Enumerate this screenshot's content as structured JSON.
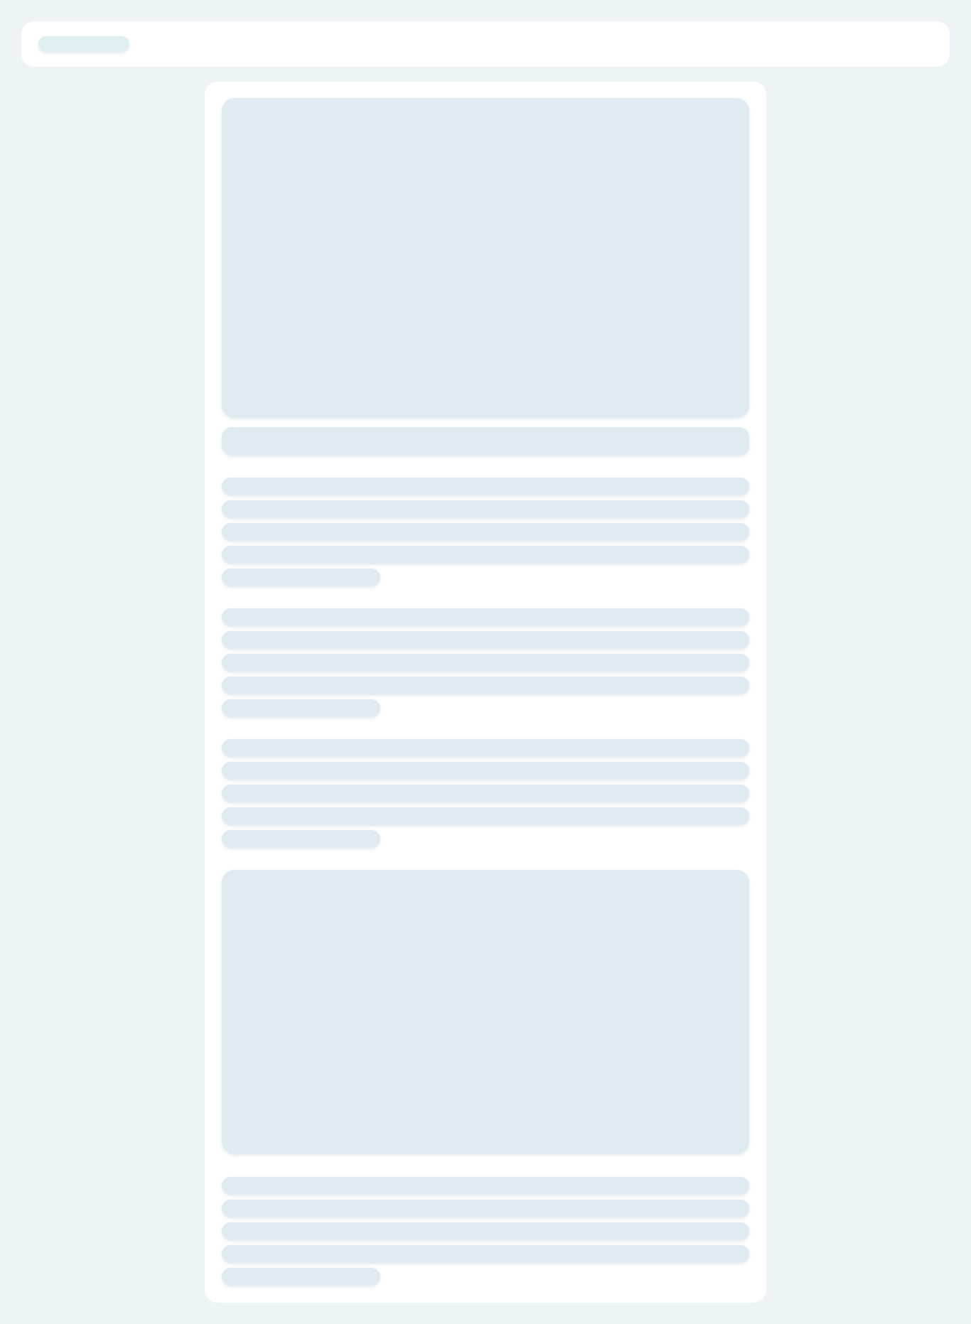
{
  "page": {
    "state": "loading skeleton",
    "colors": {
      "background": "#eef3f6",
      "surface": "#ffffff",
      "skeleton": "#dfebf0",
      "skeleton_header": "#dfeef0"
    }
  },
  "header": {},
  "article": {
    "paragraph_groups": [
      {
        "lines": 5
      },
      {
        "lines": 5
      },
      {
        "lines": 5
      },
      {
        "lines": 5
      }
    ],
    "media_blocks": 2
  }
}
